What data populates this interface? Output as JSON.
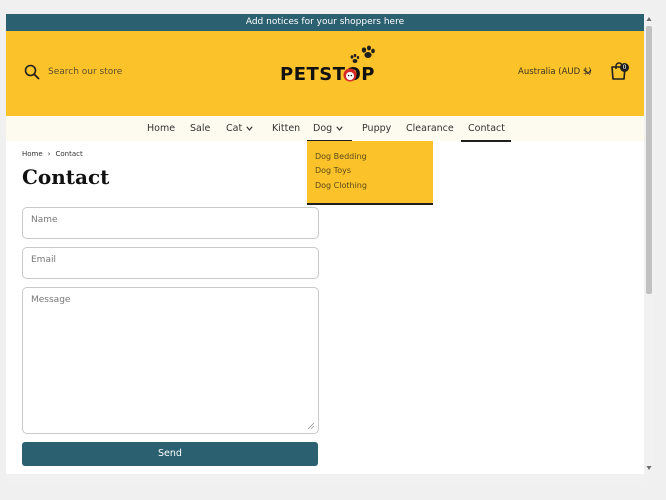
{
  "announcement": "Add notices for your shoppers here",
  "header": {
    "search_placeholder": "Search our store",
    "logo_text": "PETSTOP",
    "locale": "Australia (AUD $)",
    "cart_count": "0"
  },
  "nav": {
    "items": [
      {
        "label": "Home"
      },
      {
        "label": "Sale"
      },
      {
        "label": "Cat"
      },
      {
        "label": "Kitten"
      },
      {
        "label": "Dog"
      },
      {
        "label": "Puppy"
      },
      {
        "label": "Clearance"
      },
      {
        "label": "Contact"
      }
    ],
    "dog_dropdown": [
      "Dog Bedding",
      "Dog Toys",
      "Dog Clothing"
    ]
  },
  "breadcrumb": {
    "home": "Home",
    "current": "Contact"
  },
  "page": {
    "title": "Contact"
  },
  "form": {
    "name_placeholder": "Name",
    "email_placeholder": "Email",
    "message_placeholder": "Message",
    "send_label": "Send"
  },
  "colors": {
    "brand_yellow": "#fcc22a",
    "brand_teal": "#2b6070"
  }
}
